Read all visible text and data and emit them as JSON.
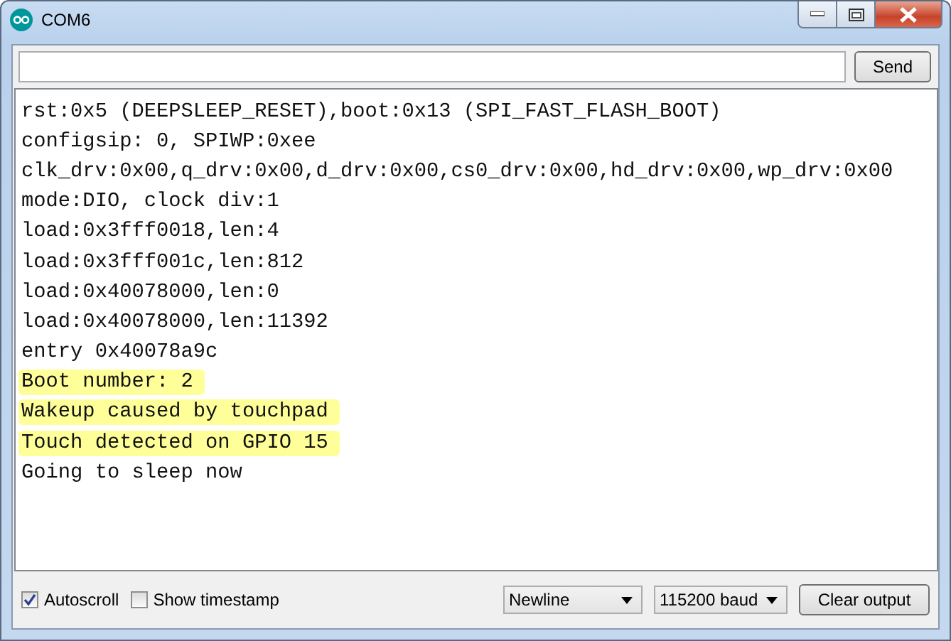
{
  "window": {
    "title": "COM6"
  },
  "send_button": "Send",
  "output_lines": [
    {
      "text": "rst:0x5 (DEEPSLEEP_RESET),boot:0x13 (SPI_FAST_FLASH_BOOT)",
      "highlighted": false
    },
    {
      "text": "configsip: 0, SPIWP:0xee",
      "highlighted": false
    },
    {
      "text": "clk_drv:0x00,q_drv:0x00,d_drv:0x00,cs0_drv:0x00,hd_drv:0x00,wp_drv:0x00",
      "highlighted": false
    },
    {
      "text": "mode:DIO, clock div:1",
      "highlighted": false
    },
    {
      "text": "load:0x3fff0018,len:4",
      "highlighted": false
    },
    {
      "text": "load:0x3fff001c,len:812",
      "highlighted": false
    },
    {
      "text": "load:0x40078000,len:0",
      "highlighted": false
    },
    {
      "text": "load:0x40078000,len:11392",
      "highlighted": false
    },
    {
      "text": "entry 0x40078a9c",
      "highlighted": false
    },
    {
      "text": "Boot number: 2",
      "highlighted": true
    },
    {
      "text": "Wakeup caused by touchpad",
      "highlighted": true
    },
    {
      "text": "Touch detected on GPIO 15",
      "highlighted": true
    },
    {
      "text": "Going to sleep now",
      "highlighted": false
    }
  ],
  "options": [
    {
      "label": "Autoscroll",
      "checked": true
    },
    {
      "label": "Show timestamp",
      "checked": false
    }
  ],
  "line_ending": "Newline",
  "baud_rate": "115200 baud",
  "clear_button": "Clear output"
}
